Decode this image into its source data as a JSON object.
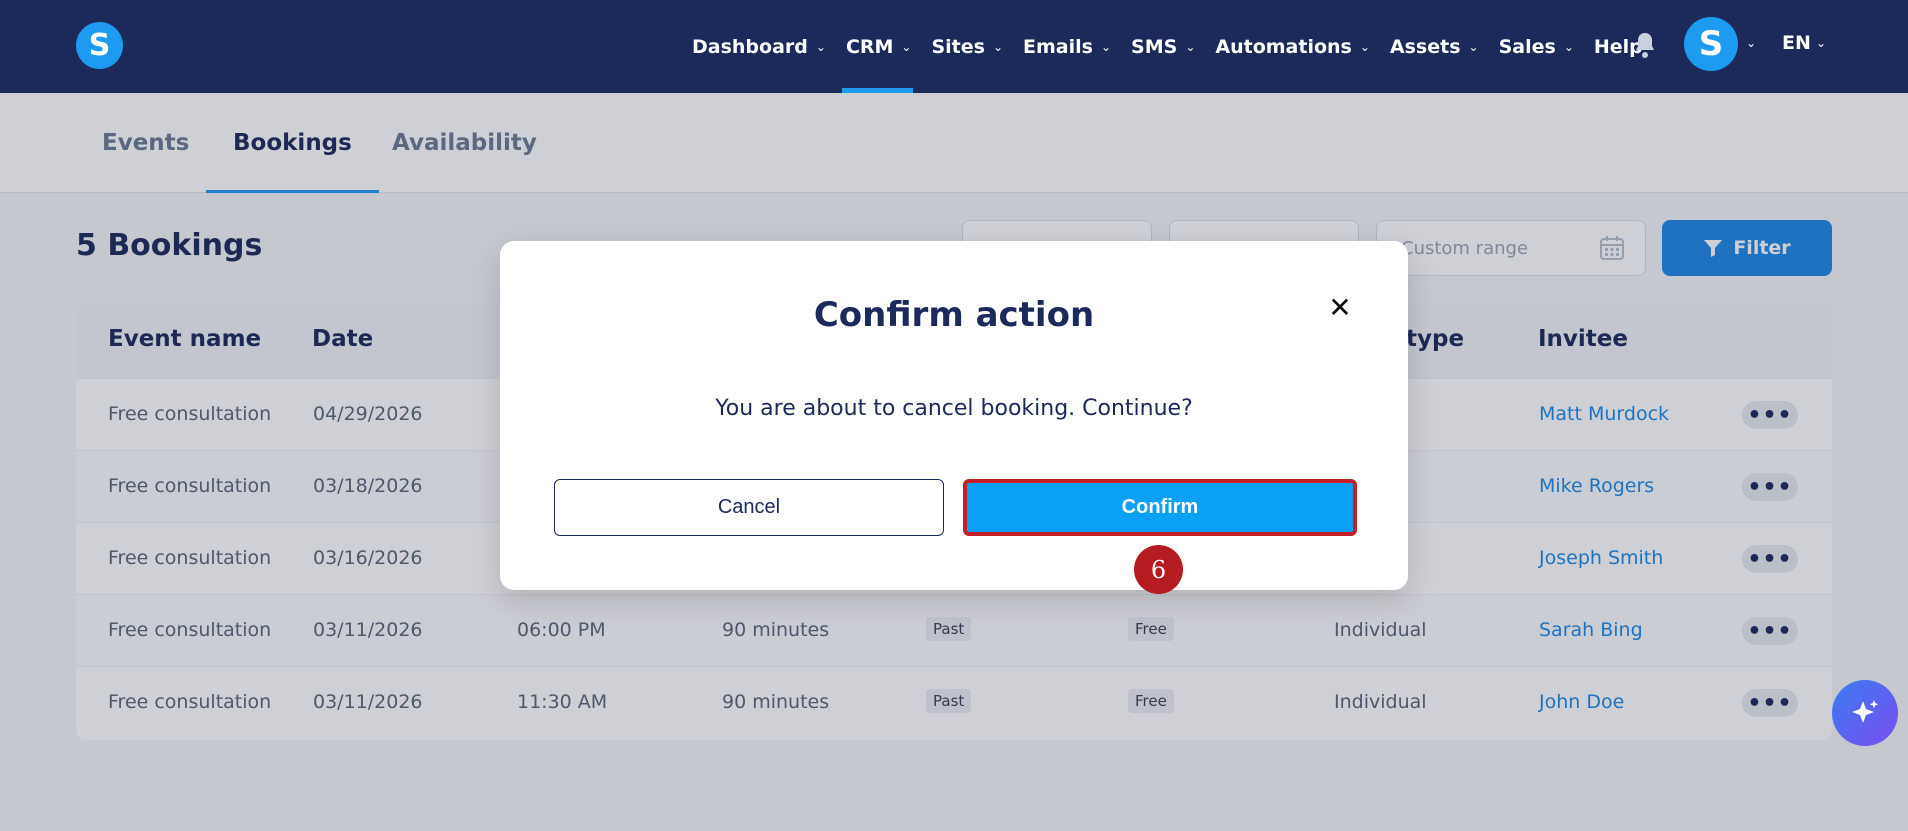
{
  "brand": {
    "logo_letter": "S"
  },
  "nav": {
    "items": [
      {
        "label": "Dashboard",
        "dropdown": true
      },
      {
        "label": "CRM",
        "dropdown": true,
        "active": true
      },
      {
        "label": "Sites",
        "dropdown": true
      },
      {
        "label": "Emails",
        "dropdown": true
      },
      {
        "label": "SMS",
        "dropdown": true
      },
      {
        "label": "Automations",
        "dropdown": true
      },
      {
        "label": "Assets",
        "dropdown": true
      },
      {
        "label": "Sales",
        "dropdown": true
      },
      {
        "label": "Help",
        "dropdown": false
      }
    ],
    "avatar_letter": "S",
    "language": "EN"
  },
  "tabs": {
    "events": "Events",
    "bookings": "Bookings",
    "availability": "Availability"
  },
  "heading": "5 Bookings",
  "range": {
    "placeholder": "Custom range"
  },
  "filter_label": "Filter",
  "table": {
    "headers": {
      "event_name": "Event name",
      "date": "Date",
      "type": "type",
      "invitee": "Invitee"
    },
    "rows": [
      {
        "event": "Free consultation",
        "date": "04/29/2026",
        "time": "",
        "duration": "",
        "status": "",
        "price": "",
        "type": "al",
        "invitee": "Matt Murdock"
      },
      {
        "event": "Free consultation",
        "date": "03/18/2026",
        "time": "",
        "duration": "",
        "status": "",
        "price": "",
        "type": "al",
        "invitee": "Mike Rogers"
      },
      {
        "event": "Free consultation",
        "date": "03/16/2026",
        "time": "",
        "duration": "",
        "status": "",
        "price": "",
        "type": "al",
        "invitee": "Joseph Smith"
      },
      {
        "event": "Free consultation",
        "date": "03/11/2026",
        "time": "06:00 PM",
        "duration": "90 minutes",
        "status": "Past",
        "price": "Free",
        "type": "Individual",
        "invitee": "Sarah Bing"
      },
      {
        "event": "Free consultation",
        "date": "03/11/2026",
        "time": "11:30 AM",
        "duration": "90 minutes",
        "status": "Past",
        "price": "Free",
        "type": "Individual",
        "invitee": "John Doe"
      }
    ]
  },
  "modal": {
    "title": "Confirm action",
    "message": "You are about to cancel booking. Continue?",
    "cancel_label": "Cancel",
    "confirm_label": "Confirm",
    "step_number": "6"
  },
  "colors": {
    "nav_bg": "#1b2a5a",
    "accent": "#1e88e5",
    "confirm_bg": "#0aa0f5",
    "highlight_border": "#c41f26"
  }
}
